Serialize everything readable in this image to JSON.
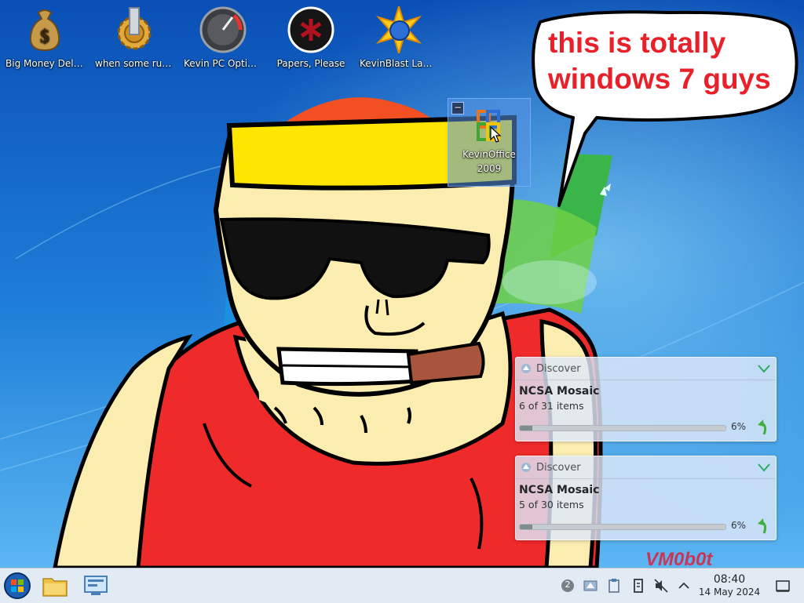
{
  "desktop": {
    "icons": [
      {
        "label": "Big Money Deluxe",
        "icon": "money-bag-icon"
      },
      {
        "label": "when some russian runs a...",
        "icon": "gear-icon"
      },
      {
        "label": "Kevin PC Optimizer Ho...",
        "icon": "speedometer-icon"
      },
      {
        "label": "Papers, Please",
        "icon": "emblem-icon"
      },
      {
        "label": "KevinBlast Launcher",
        "icon": "starburst-globe-icon"
      },
      {
        "label": "KevinOffice 2009",
        "icon": "office-logo-icon",
        "selected": true
      }
    ],
    "bubble_text": "this is totally\nwindows 7 guys",
    "watermark": "VM0b0t"
  },
  "notifications": [
    {
      "app": "Discover",
      "title": "NCSA Mosaic",
      "subtitle": "6 of 31 items",
      "progress_percent": 6,
      "progress_label": "6%"
    },
    {
      "app": "Discover",
      "title": "NCSA Mosaic",
      "subtitle": "5 of 30 items",
      "progress_percent": 6,
      "progress_label": "6%"
    }
  ],
  "taskbar": {
    "launchers": [
      {
        "icon": "start-orb-icon"
      },
      {
        "icon": "folder-icon"
      },
      {
        "icon": "explorer-icon"
      }
    ],
    "tray": {
      "notification_count": "2",
      "icons": [
        "badge-icon",
        "discover-icon",
        "clipboard-icon",
        "device-icon",
        "volume-muted-icon",
        "chevron-up-icon"
      ]
    },
    "clock": {
      "time": "08:40",
      "date": "14 May 2024"
    }
  },
  "colors": {
    "sky_top": "#0a4fb5",
    "sky_bottom": "#49a8ee",
    "accent_red": "#e8202a",
    "notification_bg": "#dde8f8",
    "taskbar_bg": "#e0e8f2"
  }
}
